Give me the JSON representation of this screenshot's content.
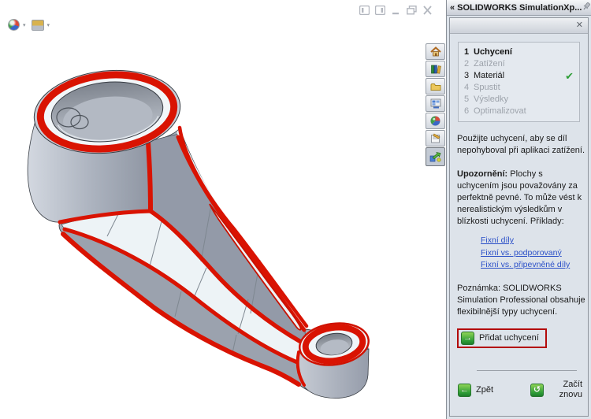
{
  "colors": {
    "fixture_red": "#d91302",
    "annotation_red": "#b30b0b",
    "check_green": "#2f9e38",
    "link_blue": "#2b50c8",
    "pane_bg": "#dde3ea"
  },
  "viewport": {
    "toolbar_icons": [
      "edit-appearance-icon",
      "apply-scene-icon"
    ],
    "window_controls": [
      "pane-left-icon",
      "pane-right-icon",
      "minimize-icon",
      "restore-icon",
      "close-icon"
    ]
  },
  "side_tabs": [
    "home-icon",
    "design-library-icon",
    "file-explorer-icon",
    "view-palette-icon",
    "appearances-icon",
    "custom-properties-icon",
    "simulationxpress-icon"
  ],
  "task_pane": {
    "collapse_chevron": "«",
    "title": "SOLIDWORKS SimulationXp...",
    "close_glyph": "✕",
    "steps": [
      {
        "num": "1",
        "label": "Uchycení"
      },
      {
        "num": "2",
        "label": "Zatížení"
      },
      {
        "num": "3",
        "label": "Materiál"
      },
      {
        "num": "4",
        "label": "Spustit"
      },
      {
        "num": "5",
        "label": "Výsledky"
      },
      {
        "num": "6",
        "label": "Optimalizovat"
      }
    ],
    "step_complete_glyph": "✔",
    "intro": "Použijte uchycení, aby se díl nepohyboval při aplikaci zatížení.",
    "warning_label": "Upozornění:",
    "warning_text": " Plochy s uchycením jsou považovány za perfektně pevné. To může vést k nerealistickým výsledkům v blízkosti uchycení. Příklady:",
    "links": [
      "Fixní díly",
      "Fixní vs. podporovaný",
      "Fixní vs. připevněné díly"
    ],
    "note": "Poznámka: SOLIDWORKS Simulation Professional obsahuje flexibilnější typy uchycení.",
    "add_fixture_label": "Přidat uchycení",
    "back_label": "Zpět",
    "restart_label": "Začít znovu",
    "icons": {
      "add_arrow": "→",
      "back_arrow": "←",
      "restart_arrow": "↺"
    }
  }
}
